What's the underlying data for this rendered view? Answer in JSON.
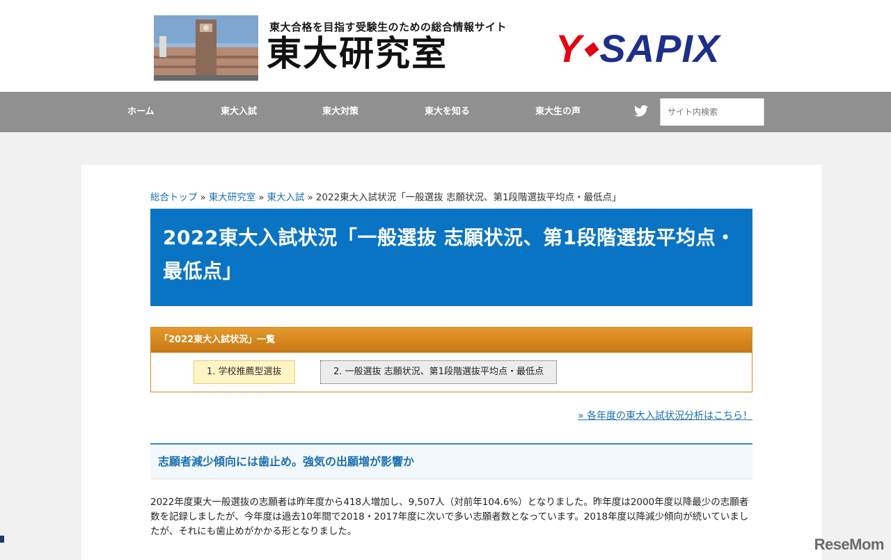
{
  "header": {
    "tagline": "東大合格を目指す受験生のための総合情報サイト",
    "title": "東大研究室",
    "brand": {
      "y": "Y",
      "rest": "SAPIX"
    },
    "photo": "university-clock-tower-photo"
  },
  "nav": {
    "items": [
      {
        "label": "ホーム"
      },
      {
        "label": "東大入試"
      },
      {
        "label": "東大対策"
      },
      {
        "label": "東大を知る"
      },
      {
        "label": "東大生の声"
      }
    ],
    "twitter_icon": "twitter-icon",
    "search_placeholder": "サイト内検索"
  },
  "breadcrumb": {
    "items": [
      "総合トップ",
      "東大研究室",
      "東大入試"
    ],
    "current": "2022東大入試状況「一般選抜 志願状況、第1段階選抜平均点・最低点」",
    "separator": "»"
  },
  "page_title": "2022東大入試状況「一般選抜 志願状況、第1段階選抜平均点・最低点」",
  "series_list": {
    "heading": "「2022東大入試状況」一覧",
    "items": [
      "1. 学校推薦型選抜",
      "2. 一般選抜 志願状況、第1段階選抜平均点・最低点"
    ]
  },
  "more_link": "» 各年度の東大入試状況分析はこちら！",
  "section_heading": "志願者減少傾向には歯止め。強気の出願増が影響か",
  "body_text": "2022年度東大一般選抜の志願者は昨年度から418人増加し、9,507人（対前年104.6%）となりました。昨年度は2000年度以降最少の志願者数を記録しましたが、今年度は過去10年間で2018・2017年度に次いで多い志願者数となっています。2018年度以降減少傾向が続いていましたが、それにも歯止めがかかる形となりました。",
  "watermark": "ReseMom",
  "colors": {
    "nav_bg": "#909090",
    "title_bg": "#0a74c4",
    "list_header": "#d4891c",
    "link": "#1a6fb0",
    "brand_red": "#e60012",
    "brand_blue": "#1e2f8a"
  }
}
